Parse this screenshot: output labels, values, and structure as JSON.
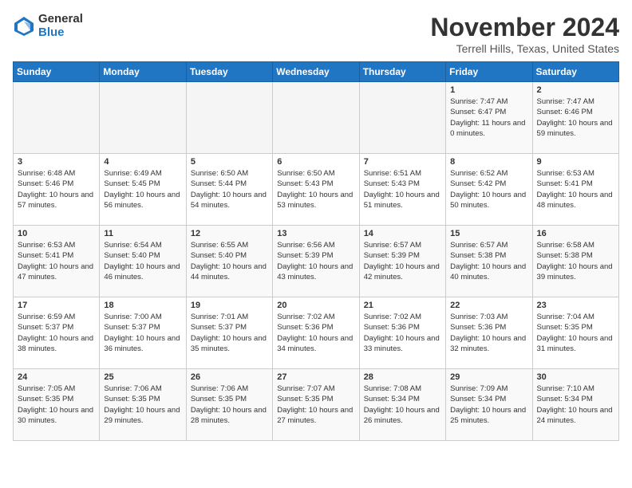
{
  "logo": {
    "general": "General",
    "blue": "Blue"
  },
  "header": {
    "month": "November 2024",
    "location": "Terrell Hills, Texas, United States"
  },
  "weekdays": [
    "Sunday",
    "Monday",
    "Tuesday",
    "Wednesday",
    "Thursday",
    "Friday",
    "Saturday"
  ],
  "weeks": [
    [
      {
        "day": "",
        "info": ""
      },
      {
        "day": "",
        "info": ""
      },
      {
        "day": "",
        "info": ""
      },
      {
        "day": "",
        "info": ""
      },
      {
        "day": "",
        "info": ""
      },
      {
        "day": "1",
        "info": "Sunrise: 7:47 AM\nSunset: 6:47 PM\nDaylight: 11 hours and 0 minutes."
      },
      {
        "day": "2",
        "info": "Sunrise: 7:47 AM\nSunset: 6:46 PM\nDaylight: 10 hours and 59 minutes."
      }
    ],
    [
      {
        "day": "3",
        "info": "Sunrise: 6:48 AM\nSunset: 5:46 PM\nDaylight: 10 hours and 57 minutes."
      },
      {
        "day": "4",
        "info": "Sunrise: 6:49 AM\nSunset: 5:45 PM\nDaylight: 10 hours and 56 minutes."
      },
      {
        "day": "5",
        "info": "Sunrise: 6:50 AM\nSunset: 5:44 PM\nDaylight: 10 hours and 54 minutes."
      },
      {
        "day": "6",
        "info": "Sunrise: 6:50 AM\nSunset: 5:43 PM\nDaylight: 10 hours and 53 minutes."
      },
      {
        "day": "7",
        "info": "Sunrise: 6:51 AM\nSunset: 5:43 PM\nDaylight: 10 hours and 51 minutes."
      },
      {
        "day": "8",
        "info": "Sunrise: 6:52 AM\nSunset: 5:42 PM\nDaylight: 10 hours and 50 minutes."
      },
      {
        "day": "9",
        "info": "Sunrise: 6:53 AM\nSunset: 5:41 PM\nDaylight: 10 hours and 48 minutes."
      }
    ],
    [
      {
        "day": "10",
        "info": "Sunrise: 6:53 AM\nSunset: 5:41 PM\nDaylight: 10 hours and 47 minutes."
      },
      {
        "day": "11",
        "info": "Sunrise: 6:54 AM\nSunset: 5:40 PM\nDaylight: 10 hours and 46 minutes."
      },
      {
        "day": "12",
        "info": "Sunrise: 6:55 AM\nSunset: 5:40 PM\nDaylight: 10 hours and 44 minutes."
      },
      {
        "day": "13",
        "info": "Sunrise: 6:56 AM\nSunset: 5:39 PM\nDaylight: 10 hours and 43 minutes."
      },
      {
        "day": "14",
        "info": "Sunrise: 6:57 AM\nSunset: 5:39 PM\nDaylight: 10 hours and 42 minutes."
      },
      {
        "day": "15",
        "info": "Sunrise: 6:57 AM\nSunset: 5:38 PM\nDaylight: 10 hours and 40 minutes."
      },
      {
        "day": "16",
        "info": "Sunrise: 6:58 AM\nSunset: 5:38 PM\nDaylight: 10 hours and 39 minutes."
      }
    ],
    [
      {
        "day": "17",
        "info": "Sunrise: 6:59 AM\nSunset: 5:37 PM\nDaylight: 10 hours and 38 minutes."
      },
      {
        "day": "18",
        "info": "Sunrise: 7:00 AM\nSunset: 5:37 PM\nDaylight: 10 hours and 36 minutes."
      },
      {
        "day": "19",
        "info": "Sunrise: 7:01 AM\nSunset: 5:37 PM\nDaylight: 10 hours and 35 minutes."
      },
      {
        "day": "20",
        "info": "Sunrise: 7:02 AM\nSunset: 5:36 PM\nDaylight: 10 hours and 34 minutes."
      },
      {
        "day": "21",
        "info": "Sunrise: 7:02 AM\nSunset: 5:36 PM\nDaylight: 10 hours and 33 minutes."
      },
      {
        "day": "22",
        "info": "Sunrise: 7:03 AM\nSunset: 5:36 PM\nDaylight: 10 hours and 32 minutes."
      },
      {
        "day": "23",
        "info": "Sunrise: 7:04 AM\nSunset: 5:35 PM\nDaylight: 10 hours and 31 minutes."
      }
    ],
    [
      {
        "day": "24",
        "info": "Sunrise: 7:05 AM\nSunset: 5:35 PM\nDaylight: 10 hours and 30 minutes."
      },
      {
        "day": "25",
        "info": "Sunrise: 7:06 AM\nSunset: 5:35 PM\nDaylight: 10 hours and 29 minutes."
      },
      {
        "day": "26",
        "info": "Sunrise: 7:06 AM\nSunset: 5:35 PM\nDaylight: 10 hours and 28 minutes."
      },
      {
        "day": "27",
        "info": "Sunrise: 7:07 AM\nSunset: 5:35 PM\nDaylight: 10 hours and 27 minutes."
      },
      {
        "day": "28",
        "info": "Sunrise: 7:08 AM\nSunset: 5:34 PM\nDaylight: 10 hours and 26 minutes."
      },
      {
        "day": "29",
        "info": "Sunrise: 7:09 AM\nSunset: 5:34 PM\nDaylight: 10 hours and 25 minutes."
      },
      {
        "day": "30",
        "info": "Sunrise: 7:10 AM\nSunset: 5:34 PM\nDaylight: 10 hours and 24 minutes."
      }
    ]
  ]
}
